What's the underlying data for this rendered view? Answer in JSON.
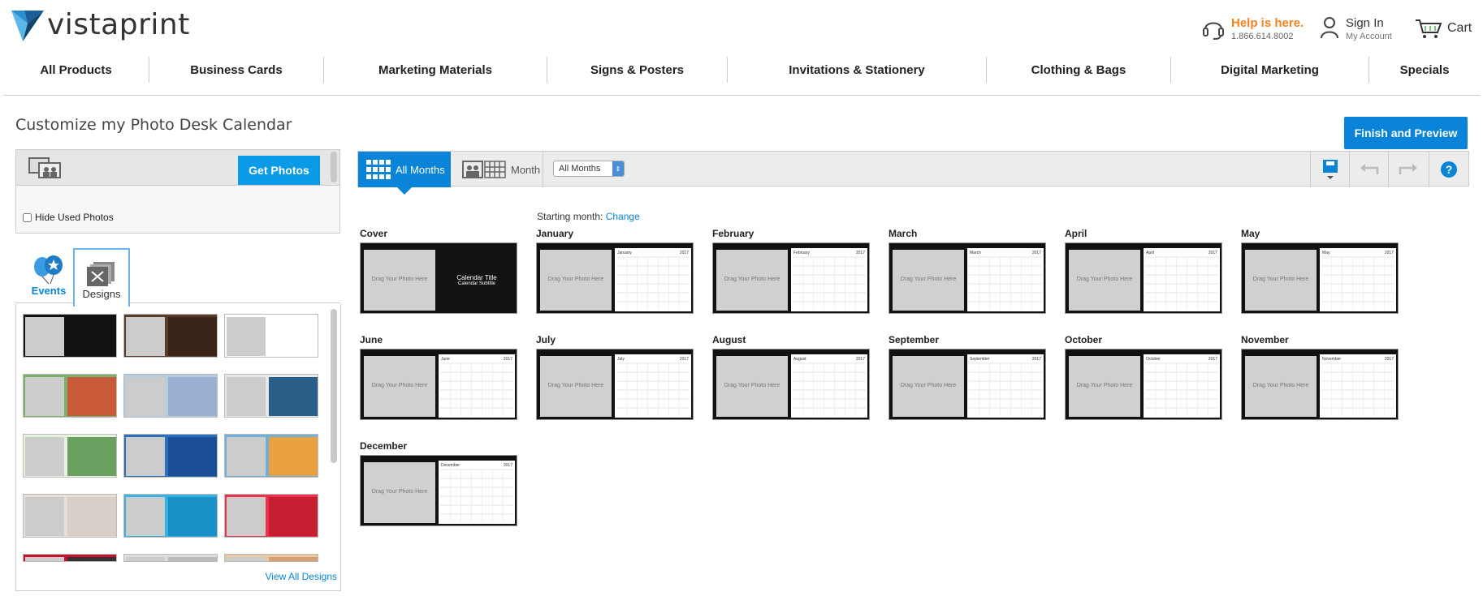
{
  "header": {
    "logo_text": "vistaprint",
    "help_title": "Help is here.",
    "help_phone": "1.866.614.8002",
    "signin_title": "Sign In",
    "signin_sub": "My Account",
    "cart_label": "Cart"
  },
  "nav": {
    "items": [
      {
        "label": "All Products"
      },
      {
        "label": "Business Cards"
      },
      {
        "label": "Marketing Materials"
      },
      {
        "label": "Signs & Posters"
      },
      {
        "label": "Invitations & Stationery"
      },
      {
        "label": "Clothing & Bags"
      },
      {
        "label": "Digital Marketing"
      },
      {
        "label": "Specials"
      }
    ]
  },
  "page": {
    "title": "Customize my Photo Desk Calendar",
    "finish_label": "Finish and Preview"
  },
  "left": {
    "get_photos_label": "Get Photos",
    "hide_used_label": "Hide Used Photos",
    "tab_events": "Events",
    "tab_designs": "Designs",
    "view_all_label": "View All Designs",
    "design_thumb_texts": {
      "photo": "Your Photo Here",
      "title": "Calendar Title",
      "subtitle": "Calendar Subtitle"
    }
  },
  "toolbar": {
    "all_months_label": "All Months",
    "month_label": "Month",
    "select_value": "All Months"
  },
  "canvas": {
    "starting_month_label": "Starting month:",
    "change_label": "Change",
    "photo_placeholder": "Drag Your Photo Here",
    "cover_title": "Calendar Title",
    "cover_subtitle": "Calendar Subtitle",
    "year": "2017",
    "months": [
      {
        "label": "Cover"
      },
      {
        "label": "January"
      },
      {
        "label": "February"
      },
      {
        "label": "March"
      },
      {
        "label": "April"
      },
      {
        "label": "May"
      },
      {
        "label": "June"
      },
      {
        "label": "July"
      },
      {
        "label": "August"
      },
      {
        "label": "September"
      },
      {
        "label": "October"
      },
      {
        "label": "November"
      },
      {
        "label": "December"
      }
    ]
  },
  "colors": {
    "accent": "#0a84d8",
    "help": "#f58220",
    "card_bg": "#111111"
  }
}
